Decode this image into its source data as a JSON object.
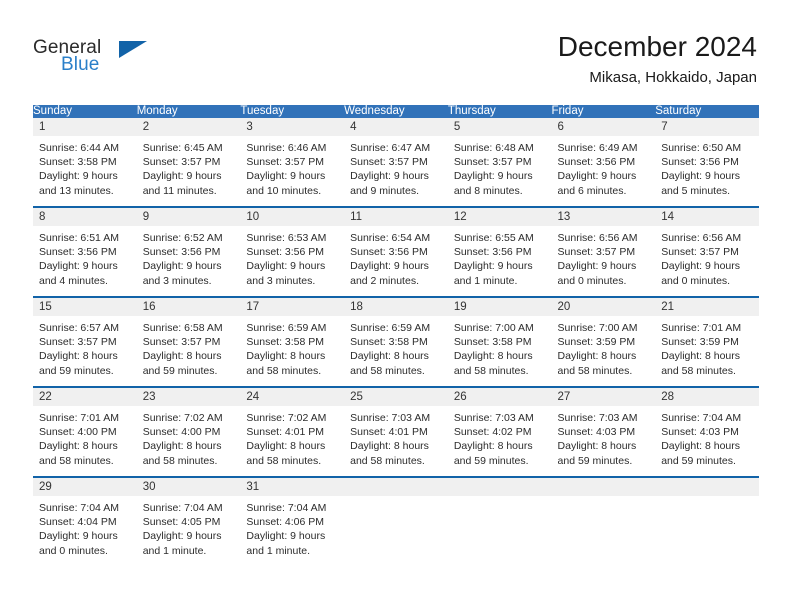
{
  "brand": {
    "name_top": "General",
    "name_bottom": "Blue",
    "color_dark": "#2b2b2b",
    "color_blue": "#2a7fc9",
    "triangle_color": "#1263a8"
  },
  "header": {
    "month_year": "December 2024",
    "location": "Mikasa, Hokkaido, Japan"
  },
  "theme": {
    "header_band": "#3172b9",
    "row_divider": "#1263a8",
    "daynum_band": "#f0f0f0",
    "text": "#2c2c2c"
  },
  "weekday_headers": [
    "Sunday",
    "Monday",
    "Tuesday",
    "Wednesday",
    "Thursday",
    "Friday",
    "Saturday"
  ],
  "weeks": [
    [
      {
        "day": "1",
        "sunrise": "Sunrise: 6:44 AM",
        "sunset": "Sunset: 3:58 PM",
        "daylight1": "Daylight: 9 hours",
        "daylight2": "and 13 minutes."
      },
      {
        "day": "2",
        "sunrise": "Sunrise: 6:45 AM",
        "sunset": "Sunset: 3:57 PM",
        "daylight1": "Daylight: 9 hours",
        "daylight2": "and 11 minutes."
      },
      {
        "day": "3",
        "sunrise": "Sunrise: 6:46 AM",
        "sunset": "Sunset: 3:57 PM",
        "daylight1": "Daylight: 9 hours",
        "daylight2": "and 10 minutes."
      },
      {
        "day": "4",
        "sunrise": "Sunrise: 6:47 AM",
        "sunset": "Sunset: 3:57 PM",
        "daylight1": "Daylight: 9 hours",
        "daylight2": "and 9 minutes."
      },
      {
        "day": "5",
        "sunrise": "Sunrise: 6:48 AM",
        "sunset": "Sunset: 3:57 PM",
        "daylight1": "Daylight: 9 hours",
        "daylight2": "and 8 minutes."
      },
      {
        "day": "6",
        "sunrise": "Sunrise: 6:49 AM",
        "sunset": "Sunset: 3:56 PM",
        "daylight1": "Daylight: 9 hours",
        "daylight2": "and 6 minutes."
      },
      {
        "day": "7",
        "sunrise": "Sunrise: 6:50 AM",
        "sunset": "Sunset: 3:56 PM",
        "daylight1": "Daylight: 9 hours",
        "daylight2": "and 5 minutes."
      }
    ],
    [
      {
        "day": "8",
        "sunrise": "Sunrise: 6:51 AM",
        "sunset": "Sunset: 3:56 PM",
        "daylight1": "Daylight: 9 hours",
        "daylight2": "and 4 minutes."
      },
      {
        "day": "9",
        "sunrise": "Sunrise: 6:52 AM",
        "sunset": "Sunset: 3:56 PM",
        "daylight1": "Daylight: 9 hours",
        "daylight2": "and 3 minutes."
      },
      {
        "day": "10",
        "sunrise": "Sunrise: 6:53 AM",
        "sunset": "Sunset: 3:56 PM",
        "daylight1": "Daylight: 9 hours",
        "daylight2": "and 3 minutes."
      },
      {
        "day": "11",
        "sunrise": "Sunrise: 6:54 AM",
        "sunset": "Sunset: 3:56 PM",
        "daylight1": "Daylight: 9 hours",
        "daylight2": "and 2 minutes."
      },
      {
        "day": "12",
        "sunrise": "Sunrise: 6:55 AM",
        "sunset": "Sunset: 3:56 PM",
        "daylight1": "Daylight: 9 hours",
        "daylight2": "and 1 minute."
      },
      {
        "day": "13",
        "sunrise": "Sunrise: 6:56 AM",
        "sunset": "Sunset: 3:57 PM",
        "daylight1": "Daylight: 9 hours",
        "daylight2": "and 0 minutes."
      },
      {
        "day": "14",
        "sunrise": "Sunrise: 6:56 AM",
        "sunset": "Sunset: 3:57 PM",
        "daylight1": "Daylight: 9 hours",
        "daylight2": "and 0 minutes."
      }
    ],
    [
      {
        "day": "15",
        "sunrise": "Sunrise: 6:57 AM",
        "sunset": "Sunset: 3:57 PM",
        "daylight1": "Daylight: 8 hours",
        "daylight2": "and 59 minutes."
      },
      {
        "day": "16",
        "sunrise": "Sunrise: 6:58 AM",
        "sunset": "Sunset: 3:57 PM",
        "daylight1": "Daylight: 8 hours",
        "daylight2": "and 59 minutes."
      },
      {
        "day": "17",
        "sunrise": "Sunrise: 6:59 AM",
        "sunset": "Sunset: 3:58 PM",
        "daylight1": "Daylight: 8 hours",
        "daylight2": "and 58 minutes."
      },
      {
        "day": "18",
        "sunrise": "Sunrise: 6:59 AM",
        "sunset": "Sunset: 3:58 PM",
        "daylight1": "Daylight: 8 hours",
        "daylight2": "and 58 minutes."
      },
      {
        "day": "19",
        "sunrise": "Sunrise: 7:00 AM",
        "sunset": "Sunset: 3:58 PM",
        "daylight1": "Daylight: 8 hours",
        "daylight2": "and 58 minutes."
      },
      {
        "day": "20",
        "sunrise": "Sunrise: 7:00 AM",
        "sunset": "Sunset: 3:59 PM",
        "daylight1": "Daylight: 8 hours",
        "daylight2": "and 58 minutes."
      },
      {
        "day": "21",
        "sunrise": "Sunrise: 7:01 AM",
        "sunset": "Sunset: 3:59 PM",
        "daylight1": "Daylight: 8 hours",
        "daylight2": "and 58 minutes."
      }
    ],
    [
      {
        "day": "22",
        "sunrise": "Sunrise: 7:01 AM",
        "sunset": "Sunset: 4:00 PM",
        "daylight1": "Daylight: 8 hours",
        "daylight2": "and 58 minutes."
      },
      {
        "day": "23",
        "sunrise": "Sunrise: 7:02 AM",
        "sunset": "Sunset: 4:00 PM",
        "daylight1": "Daylight: 8 hours",
        "daylight2": "and 58 minutes."
      },
      {
        "day": "24",
        "sunrise": "Sunrise: 7:02 AM",
        "sunset": "Sunset: 4:01 PM",
        "daylight1": "Daylight: 8 hours",
        "daylight2": "and 58 minutes."
      },
      {
        "day": "25",
        "sunrise": "Sunrise: 7:03 AM",
        "sunset": "Sunset: 4:01 PM",
        "daylight1": "Daylight: 8 hours",
        "daylight2": "and 58 minutes."
      },
      {
        "day": "26",
        "sunrise": "Sunrise: 7:03 AM",
        "sunset": "Sunset: 4:02 PM",
        "daylight1": "Daylight: 8 hours",
        "daylight2": "and 59 minutes."
      },
      {
        "day": "27",
        "sunrise": "Sunrise: 7:03 AM",
        "sunset": "Sunset: 4:03 PM",
        "daylight1": "Daylight: 8 hours",
        "daylight2": "and 59 minutes."
      },
      {
        "day": "28",
        "sunrise": "Sunrise: 7:04 AM",
        "sunset": "Sunset: 4:03 PM",
        "daylight1": "Daylight: 8 hours",
        "daylight2": "and 59 minutes."
      }
    ],
    [
      {
        "day": "29",
        "sunrise": "Sunrise: 7:04 AM",
        "sunset": "Sunset: 4:04 PM",
        "daylight1": "Daylight: 9 hours",
        "daylight2": "and 0 minutes."
      },
      {
        "day": "30",
        "sunrise": "Sunrise: 7:04 AM",
        "sunset": "Sunset: 4:05 PM",
        "daylight1": "Daylight: 9 hours",
        "daylight2": "and 1 minute."
      },
      {
        "day": "31",
        "sunrise": "Sunrise: 7:04 AM",
        "sunset": "Sunset: 4:06 PM",
        "daylight1": "Daylight: 9 hours",
        "daylight2": "and 1 minute."
      },
      {
        "day": "",
        "sunrise": "",
        "sunset": "",
        "daylight1": "",
        "daylight2": ""
      },
      {
        "day": "",
        "sunrise": "",
        "sunset": "",
        "daylight1": "",
        "daylight2": ""
      },
      {
        "day": "",
        "sunrise": "",
        "sunset": "",
        "daylight1": "",
        "daylight2": ""
      },
      {
        "day": "",
        "sunrise": "",
        "sunset": "",
        "daylight1": "",
        "daylight2": ""
      }
    ]
  ]
}
